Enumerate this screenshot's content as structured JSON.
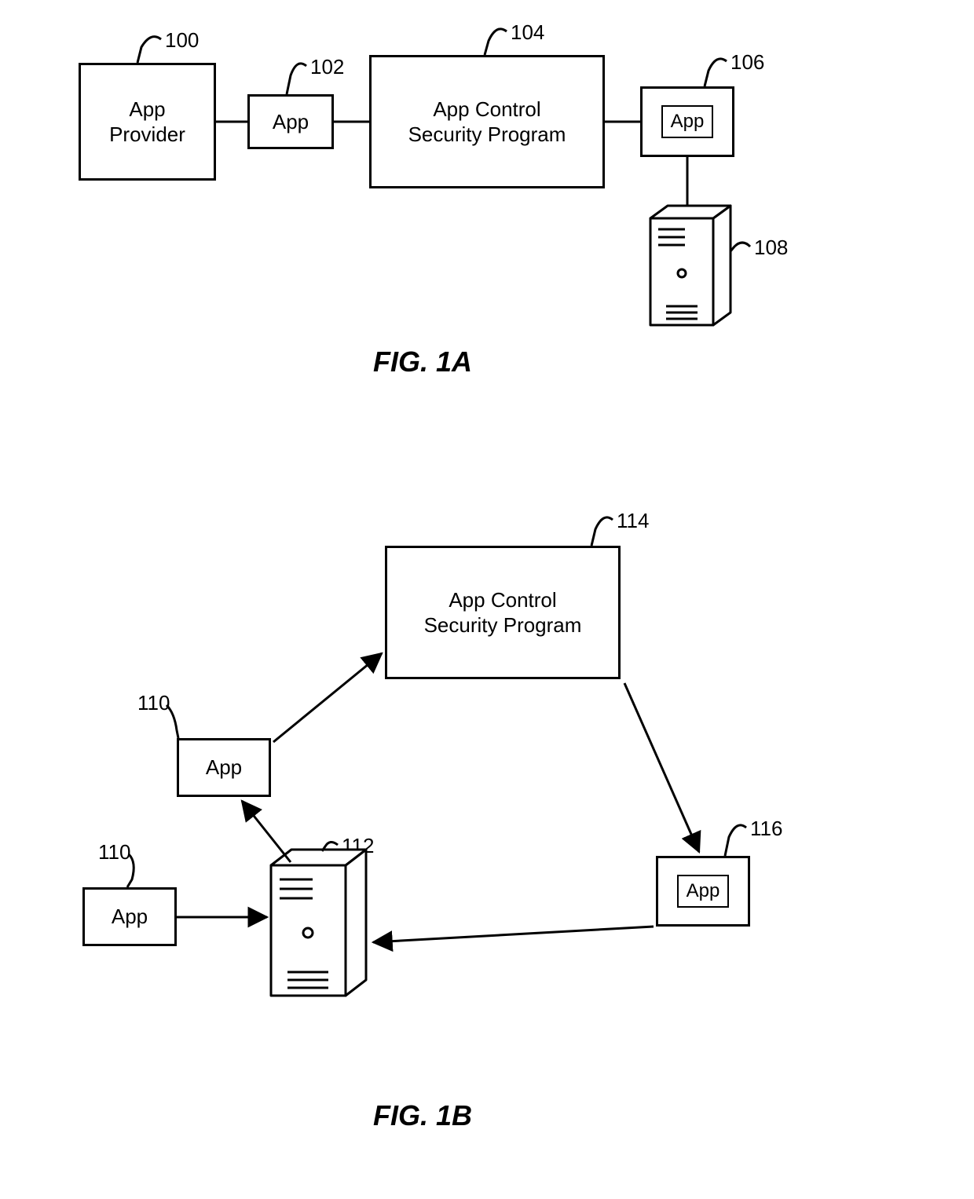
{
  "figA": {
    "title": "FIG. 1A",
    "nodes": {
      "provider": {
        "label": "App\nProvider",
        "ref": "100"
      },
      "app": {
        "label": "App",
        "ref": "102"
      },
      "security": {
        "label": "App Control\nSecurity Program",
        "ref": "104"
      },
      "wrapped": {
        "label": "App",
        "ref": "106"
      },
      "server": {
        "ref": "108"
      }
    }
  },
  "figB": {
    "title": "FIG. 1B",
    "nodes": {
      "app1": {
        "label": "App",
        "ref": "110"
      },
      "app2": {
        "label": "App",
        "ref": "110"
      },
      "server": {
        "ref": "112"
      },
      "security": {
        "label": "App Control\nSecurity Program",
        "ref": "114"
      },
      "wrapped": {
        "label": "App",
        "ref": "116"
      }
    }
  }
}
